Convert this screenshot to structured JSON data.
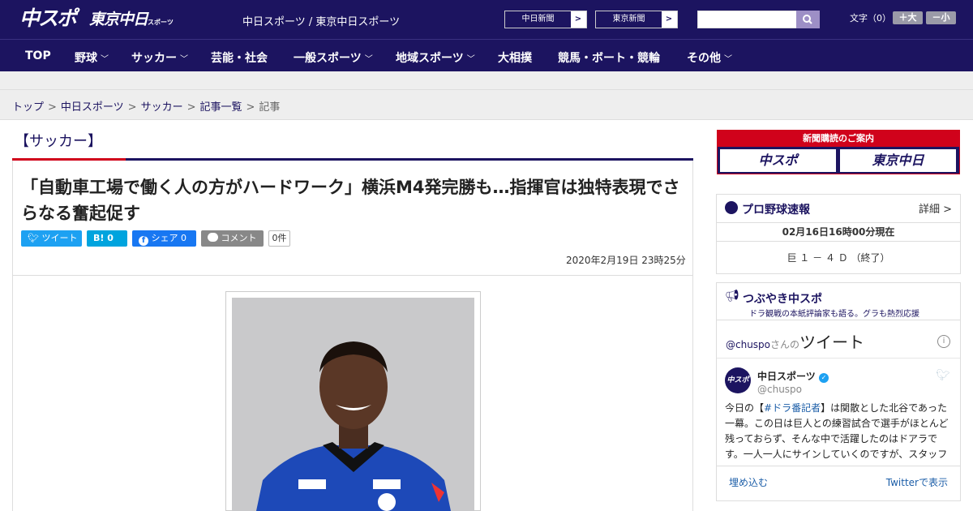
{
  "header": {
    "logo_chuspo": "中スポ",
    "logo_tokyo": "東京中日",
    "logo_tokyo_sub": "スポーツ",
    "site_links": "中日スポーツ / 東京中日スポーツ",
    "paper_btn_1": "中日新聞",
    "paper_btn_2": "東京新聞",
    "arrow": ">",
    "font_label": "文字（0）",
    "font_large": "＋大",
    "font_small": "－小"
  },
  "nav": [
    "TOP",
    "野球",
    "サッカー",
    "芸能・社会",
    "一般スポーツ",
    "地域スポーツ",
    "大相撲",
    "競馬・ボート・競輪",
    "その他"
  ],
  "breadcrumb": [
    "トップ",
    "中日スポーツ",
    "サッカー",
    "記事一覧",
    "記事"
  ],
  "breadcrumb_sep": ">",
  "article": {
    "category": "【サッカー】",
    "headline": "「自動車工場で働く人の方がハードワーク」横浜M4発完勝も…指揮官は独特表現でさらなる奮起促す",
    "share": {
      "tweet": "ツイート",
      "hatena": "B! 0",
      "facebook": "シェア 0",
      "comment": "コメント",
      "count": "0件"
    },
    "date": "2020年2月19日 23時25分"
  },
  "sidebar": {
    "subscribe_title": "新聞購読のご案内",
    "subscribe_1": "中スポ",
    "subscribe_2": "東京中日",
    "baseball": {
      "title": "プロ野球速報",
      "detail": "詳細 >",
      "asof": "02月16日16時00分現在",
      "score": "巨 １ － ４ Ｄ （終了）"
    },
    "tsubuyaki": {
      "title": "つぶやき中スポ",
      "subtitle": "ドラ観戦の本紙評論家も語る。グラも熱烈応援",
      "handle_prefix": "@chuspo",
      "handle_suffix": "さんの",
      "tweets_label": "ツイート",
      "account_name": "中日スポーツ",
      "account_handle": "@chuspo",
      "tweet_pre": "今日の【",
      "tweet_tag": "#ドラ番記者",
      "tweet_post": "】は関散とした北谷であった一幕。この日は巨人との練習試合で選手がほとんど残っておらず、そんな中で活躍したのはドアラです。一人一人にサインしていくのですが、スタッフ",
      "embed": "埋め込む",
      "view_on": "Twitterで表示"
    }
  },
  "colors": {
    "brand": "#1c1460",
    "accent": "#d0021b",
    "twitter": "#1da1f2",
    "facebook": "#1877f2",
    "hatena": "#00a4de"
  }
}
